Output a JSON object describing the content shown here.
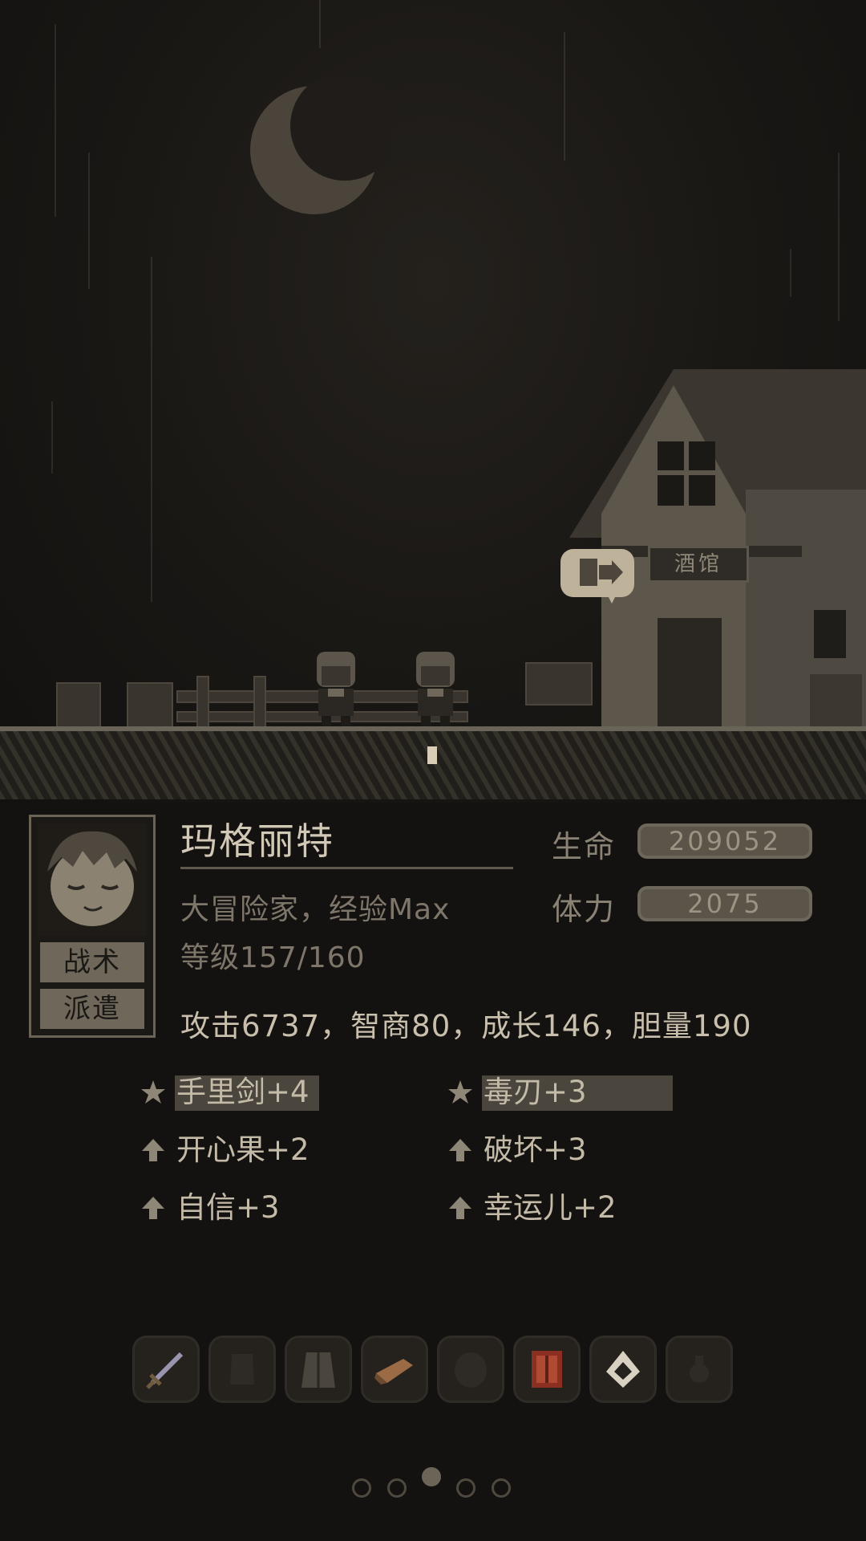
{
  "character": {
    "name": "玛格丽特",
    "title": "大冒险家，经验Max",
    "level": "等级157/160",
    "attributes": "攻击6737，智商80，成长146，胆量190"
  },
  "stats": {
    "hp_label": "生命",
    "hp_value": "209052",
    "stamina_label": "体力",
    "stamina_value": "2075"
  },
  "buttons": {
    "tactics": "战术",
    "dispatch": "派遣"
  },
  "tavern_sign": "酒馆",
  "skills": [
    {
      "label": "手里剑+4",
      "icon": "star-icon",
      "highlighted": true
    },
    {
      "label": "毒刃+3",
      "icon": "star-icon",
      "highlighted": true
    },
    {
      "label": "开心果+2",
      "icon": "up-arrow-icon",
      "highlighted": false
    },
    {
      "label": "破坏+3",
      "icon": "up-arrow-icon",
      "highlighted": false
    },
    {
      "label": "自信+3",
      "icon": "up-arrow-icon",
      "highlighted": false
    },
    {
      "label": "幸运儿+2",
      "icon": "up-arrow-icon",
      "highlighted": false
    }
  ],
  "equipment_slots": [
    {
      "icon": "sword-icon",
      "filled": true
    },
    {
      "icon": "armor-empty-icon",
      "filled": false
    },
    {
      "icon": "robe-icon",
      "filled": true
    },
    {
      "icon": "boots-icon",
      "filled": true
    },
    {
      "icon": "cloak-empty-icon",
      "filled": false
    },
    {
      "icon": "book-icon",
      "filled": true
    },
    {
      "icon": "ring-icon",
      "filled": true
    },
    {
      "icon": "potion-empty-icon",
      "filled": false
    }
  ],
  "pagination": {
    "total": 5,
    "current": 3
  },
  "colors": {
    "background": "#141210",
    "text": "#c4baa8",
    "panel_button": "#6e675a",
    "highlight": "#4a453d"
  }
}
